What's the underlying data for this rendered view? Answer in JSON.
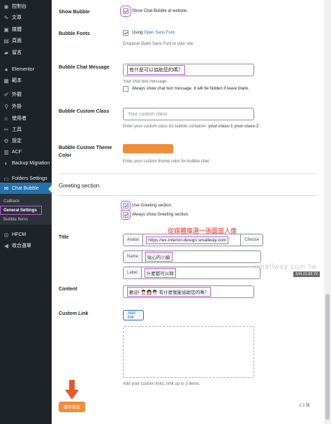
{
  "sidebar": {
    "items": [
      {
        "icon": "dashboard-icon",
        "glyph": "◉",
        "label": "控制台"
      },
      {
        "icon": "posts-icon",
        "glyph": "✎",
        "label": "文章"
      },
      {
        "icon": "media-icon",
        "glyph": "▣",
        "label": "媒體"
      },
      {
        "icon": "pages-icon",
        "glyph": "▤",
        "label": "頁面"
      },
      {
        "icon": "comments-icon",
        "glyph": "▰",
        "label": "留言"
      },
      {
        "icon": "elementor-icon",
        "glyph": "●",
        "label": "Elementor"
      },
      {
        "icon": "templates-icon",
        "glyph": "▦",
        "label": "範本"
      },
      {
        "icon": "appearance-icon",
        "glyph": "✐",
        "label": "外觀"
      },
      {
        "icon": "plugins-icon",
        "glyph": "⚲",
        "label": "外掛"
      },
      {
        "icon": "users-icon",
        "glyph": "☺",
        "label": "使用者"
      },
      {
        "icon": "tools-icon",
        "glyph": "✂",
        "label": "工具"
      },
      {
        "icon": "settings-icon",
        "glyph": "⚙",
        "label": "設定"
      },
      {
        "icon": "acf-icon",
        "glyph": "▥",
        "label": "ACF"
      },
      {
        "icon": "backup-icon",
        "glyph": "◐",
        "label": "Backup Migration"
      },
      {
        "icon": "folders-icon",
        "glyph": "▭",
        "label": "Folders Settings"
      }
    ],
    "active": {
      "icon": "chat-icon",
      "glyph": "✉",
      "label": "Chat Bubble"
    },
    "submenu": [
      "Callback",
      "General Settings",
      "Bubble Items"
    ],
    "after": [
      {
        "icon": "hfcm-icon",
        "glyph": "◎",
        "label": "HFCM"
      },
      {
        "icon": "collapse-icon",
        "glyph": "◀",
        "label": "收合選單"
      }
    ]
  },
  "form": {
    "show_bubble": {
      "label": "Show Bubble",
      "text": "Show Chat Bubble at website."
    },
    "bubble_fonts": {
      "label": "Bubble Fonts",
      "text_prefix": "Using ",
      "link": "Open Sans Font",
      "text_suffix": ".",
      "desc": "Enqueue Open Sans Font to your site."
    },
    "chat_message": {
      "label": "Bubble Chat Message",
      "value": "有什麼可以協助您的嗎？",
      "desc": "Your chat text message",
      "always_text": "Always show chat text message. It will be hidden if leave blank."
    },
    "custom_class": {
      "label": "Bubble Custom Class",
      "placeholder": "Your custom class",
      "desc_prefix": "Enter your custom class for bubble container: ",
      "desc_code": "your-class-1 your-class-2"
    },
    "theme_color": {
      "label": "Bubble Custom Theme Color",
      "color": "#f28c38",
      "desc": "Enter your custom theme color for bubble chat."
    },
    "greeting_title": "Greeting section",
    "greeting_use": "Use Greeting section.",
    "greeting_always": "Always show Greeting section.",
    "title": {
      "label": "Title",
      "avatar_label": "Avatar",
      "avatar_url": "https://ex-interior-design.smallway.com",
      "choose": "Choose",
      "name_label": "Name",
      "name_value": "貼心的小編",
      "label_label": "Label",
      "label_value": "什麼都可以問"
    },
    "content": {
      "label": "Content",
      "value": "歡迎! 🧑🏻‍🦱👩🏻👨🏻 有什麼我能協助您的嗎？"
    },
    "custom_link": {
      "label": "Custom Link",
      "add_btn": "Add link",
      "desc": "Add your custom links, limit up to 3 items."
    },
    "save": "儲存設定",
    "version": "2.3 版"
  },
  "overlay": {
    "red_text": "從媒體庫選一張圖當人像",
    "watermark": "smallway.com.tw",
    "ip": "104.21.62.72"
  }
}
